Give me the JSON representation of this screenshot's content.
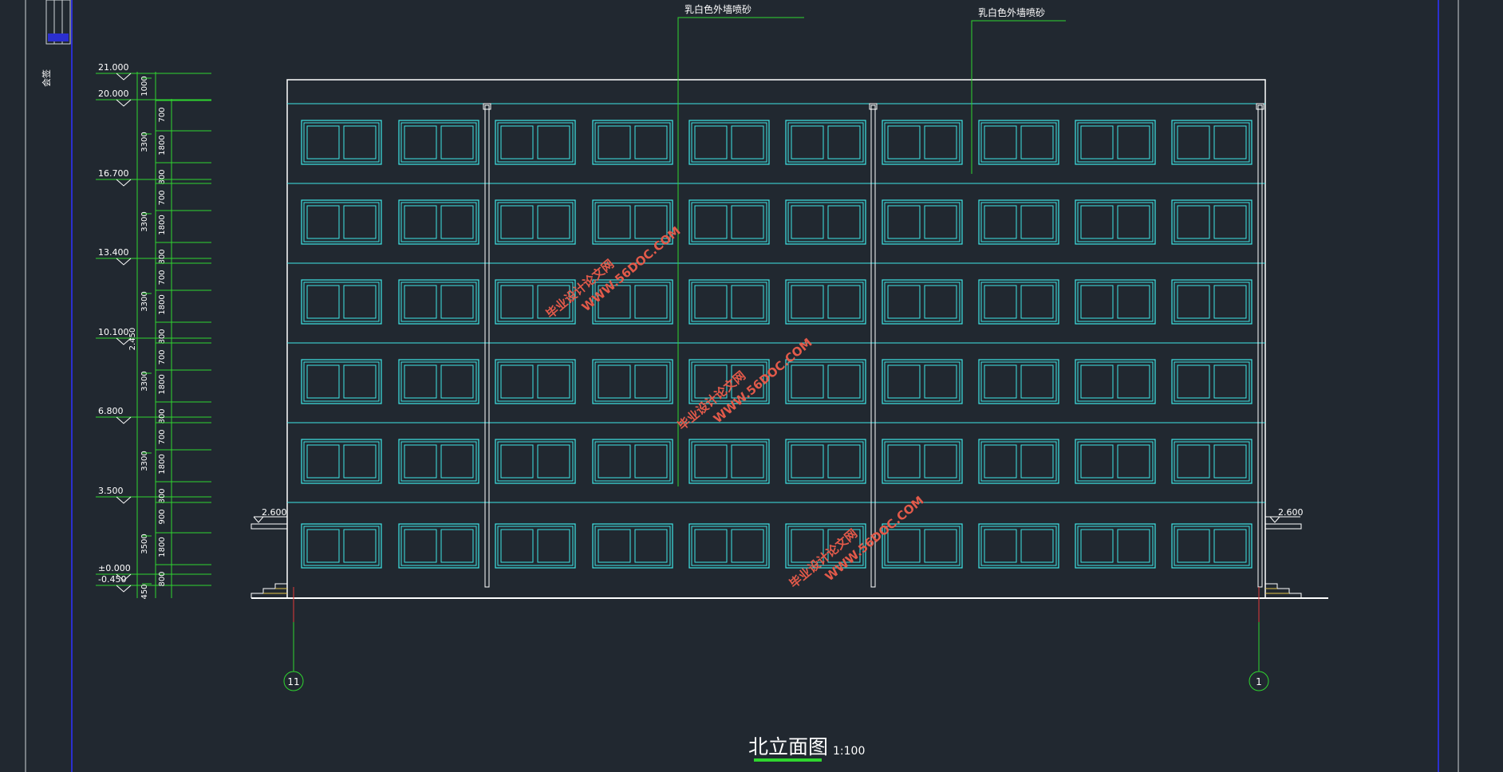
{
  "drawing": {
    "title": "北立面图",
    "scale": "1:100",
    "side_note": "会签"
  },
  "annotations": {
    "finish_left": "乳白色外墙喷砂",
    "finish_right": "乳白色外墙喷砂"
  },
  "elevations": [
    "21.000",
    "20.000",
    "16.700",
    "13.400",
    "10.100",
    "6.800",
    "3.500",
    "±0.000",
    "-0.450"
  ],
  "entrance_levels": {
    "left": "2.600",
    "right": "2.600"
  },
  "extra_dim": "2.450",
  "outer_dims": [
    "1000",
    "3300",
    "3300",
    "3300",
    "3300",
    "3300",
    "3500",
    "450"
  ],
  "inner_dims": [
    "700",
    "1800",
    "800",
    "700",
    "1800",
    "800",
    "700",
    "1800",
    "800",
    "700",
    "1800",
    "800",
    "700",
    "1800",
    "800",
    "900",
    "1800",
    "800"
  ],
  "axes": {
    "left": "11",
    "right": "1"
  },
  "watermarks": [
    {
      "line1": "毕业设计论文网",
      "line2": "WWW.56DOC.COM"
    },
    {
      "line1": "毕业设计论文网",
      "line2": "WWW.56DOC.COM"
    },
    {
      "line1": "毕业设计论文网",
      "line2": "WWW.56DOC.COM"
    }
  ],
  "colors": {
    "background": "#212830",
    "outline": "#ffffff",
    "windows": "#3ee6e6",
    "dimensions": "#2fd62f",
    "watermark": "#e35a4a",
    "frame": "#2b2fd0"
  }
}
